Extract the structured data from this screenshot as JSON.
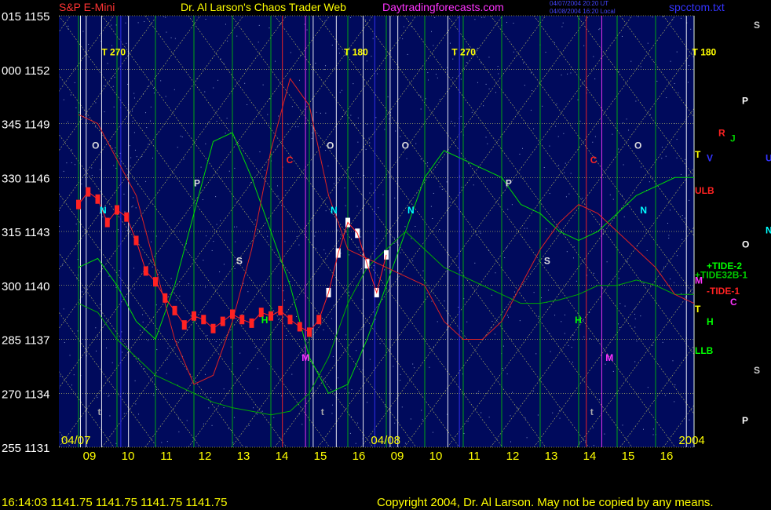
{
  "header": {
    "code_title": "S&P E-Mini",
    "site_title": "Dr. Al Larson's Chaos Trader Web",
    "site_url": "Daytradingforecasts.com",
    "timestamp_1": "04/07/2004 20:20 UT",
    "timestamp_2": "04/08/2004 16:20 Local",
    "file_name": "spcctom.txt"
  },
  "footer": {
    "quote": "16:14:03  1141.75 1141.75 1141.75 1141.75",
    "copyright": "Copyright 2004, Dr. Al Larson. May not be copied by any means."
  },
  "colors": {
    "background": "#000000",
    "plot_bg": "#000a5c",
    "price_bar": "#ff2222",
    "price_bar_today": "#ffffff",
    "tide_line": "#00cc00",
    "red_line": "#dd2222",
    "grid_yellow": "#ffff66",
    "header_red": "#ff3333",
    "header_magenta": "#ff33ff",
    "header_blue": "#3333ff"
  },
  "chart_data": {
    "type": "line",
    "title": "S&P E-Mini",
    "y_labels": [
      {
        "angle": "015",
        "price": "1155"
      },
      {
        "angle": "000",
        "price": "1152"
      },
      {
        "angle": "345",
        "price": "1149"
      },
      {
        "angle": "330",
        "price": "1146"
      },
      {
        "angle": "315",
        "price": "1143"
      },
      {
        "angle": "300",
        "price": "1140"
      },
      {
        "angle": "285",
        "price": "1137"
      },
      {
        "angle": "270",
        "price": "1134"
      },
      {
        "angle": "255",
        "price": "1131"
      }
    ],
    "ylim": [
      1131,
      1155
    ],
    "x_ticks": [
      "09",
      "10",
      "11",
      "12",
      "13",
      "14",
      "15",
      "16",
      "09",
      "10",
      "11",
      "12",
      "13",
      "14",
      "15",
      "16"
    ],
    "date_labels": [
      "04/07",
      "04/08",
      "2004"
    ],
    "hours_per_day": 8,
    "price_series": {
      "name": "S&P E-Mini",
      "x": [
        0,
        0.25,
        0.5,
        0.75,
        1,
        1.25,
        1.5,
        1.75,
        2,
        2.25,
        2.5,
        2.75,
        3,
        3.25,
        3.5,
        3.75,
        4,
        4.25,
        4.5,
        4.75,
        5,
        5.25,
        5.5,
        5.75,
        6,
        6.25,
        6.5,
        6.75,
        7,
        7.25,
        7.5,
        7.75,
        8
      ],
      "y": [
        1144.5,
        1145.2,
        1144.8,
        1143.5,
        1144.2,
        1143.8,
        1142.5,
        1140.8,
        1140.2,
        1139.3,
        1138.6,
        1137.8,
        1138.3,
        1138.1,
        1137.6,
        1138.0,
        1138.4,
        1138.1,
        1137.9,
        1138.5,
        1138.3,
        1138.6,
        1138.1,
        1137.7,
        1137.4,
        1138.1,
        1139.6,
        1141.8,
        1143.5,
        1142.9,
        1141.2,
        1139.6,
        1141.7
      ]
    },
    "series": [
      {
        "name": "TIDE-2",
        "color": "#00dd00",
        "x": [
          0,
          0.5,
          1,
          1.5,
          2,
          2.5,
          3,
          3.5,
          4,
          4.5,
          5,
          5.5,
          6,
          6.5,
          7,
          7.5,
          8,
          8.5,
          9,
          9.5,
          10,
          10.5,
          11,
          11.5,
          12,
          12.5,
          13,
          13.5,
          14,
          14.5,
          15,
          15.5,
          16
        ],
        "y": [
          1141,
          1141.5,
          1140,
          1138,
          1137,
          1140,
          1144,
          1148,
          1148.5,
          1146,
          1143,
          1140,
          1136,
          1134,
          1134.5,
          1137,
          1140,
          1143,
          1146,
          1147.5,
          1147,
          1146.5,
          1146,
          1144.5,
          1144,
          1143,
          1142.5,
          1143,
          1144,
          1145,
          1145.5,
          1146,
          1146
        ]
      },
      {
        "name": "+TIDE32B-1",
        "color": "#00aa00",
        "x": [
          0,
          0.5,
          1,
          1.5,
          2,
          2.5,
          3,
          3.5,
          4,
          4.5,
          5,
          5.5,
          6,
          6.5,
          7,
          7.5,
          8,
          8.5,
          9,
          9.5,
          10,
          10.5,
          11,
          11.5,
          12,
          12.5,
          13,
          13.5,
          14,
          14.5,
          15,
          15.5,
          16
        ],
        "y": [
          1139,
          1138.5,
          1137,
          1136,
          1135,
          1134.5,
          1134,
          1133.5,
          1133.2,
          1133,
          1132.8,
          1133,
          1134,
          1136,
          1139,
          1141,
          1142,
          1143,
          1142,
          1141,
          1140.5,
          1140,
          1139.5,
          1139,
          1139,
          1139.2,
          1139.5,
          1140,
          1140,
          1140.3,
          1140,
          1139.5,
          1139.5
        ]
      },
      {
        "name": "-TIDE-1",
        "color": "#dd2222",
        "x": [
          0,
          0.5,
          1,
          1.5,
          2,
          2.5,
          3,
          3.5,
          4,
          4.5,
          5,
          5.5,
          6,
          6.5,
          7,
          7.5,
          8,
          8.5,
          9,
          9.5,
          10,
          10.5,
          11,
          11.5,
          12,
          12.5,
          13,
          13.5,
          14,
          14.5,
          15,
          15.5,
          16
        ],
        "y": [
          1149.5,
          1149,
          1147,
          1145,
          1141,
          1137,
          1134.5,
          1135,
          1138,
          1142,
          1147.5,
          1151.5,
          1150,
          1145,
          1142,
          1141.5,
          1141,
          1140.5,
          1140,
          1138,
          1137,
          1137,
          1138,
          1140,
          1142,
          1143.5,
          1144.5,
          1144,
          1143,
          1142,
          1141,
          1139.5,
          1139
        ]
      }
    ],
    "point_labels": [
      {
        "text": "T 270",
        "day_x": 0.6,
        "price": 1152.8,
        "color": "#ffff00"
      },
      {
        "text": "T 180",
        "day_x": 6.9,
        "price": 1152.8,
        "color": "#ffff00"
      },
      {
        "text": "T 270",
        "day_x": 9.7,
        "price": 1152.8,
        "color": "#ffff00"
      },
      {
        "text": "T 180",
        "day_x": 15.95,
        "price": 1152.8,
        "color": "#ffff00"
      },
      {
        "text": "O",
        "day_x": 0.35,
        "price": 1147.6,
        "color": "#dddddd"
      },
      {
        "text": "O",
        "day_x": 6.45,
        "price": 1147.6,
        "color": "#dddddd"
      },
      {
        "text": "O",
        "day_x": 8.4,
        "price": 1147.6,
        "color": "#dddddd"
      },
      {
        "text": "O",
        "day_x": 14.45,
        "price": 1147.6,
        "color": "#dddddd"
      },
      {
        "text": "P",
        "day_x": 3.0,
        "price": 1145.5,
        "color": "#dddddd"
      },
      {
        "text": "P",
        "day_x": 11.1,
        "price": 1145.5,
        "color": "#dddddd"
      },
      {
        "text": "S",
        "day_x": 4.1,
        "price": 1141.2,
        "color": "#dddddd"
      },
      {
        "text": "S",
        "day_x": 12.1,
        "price": 1141.2,
        "color": "#dddddd"
      },
      {
        "text": "C",
        "day_x": 5.4,
        "price": 1146.8,
        "color": "#ff2222"
      },
      {
        "text": "C",
        "day_x": 13.3,
        "price": 1146.8,
        "color": "#ff2222"
      },
      {
        "text": "N",
        "day_x": 0.55,
        "price": 1144.0,
        "color": "#00ffff"
      },
      {
        "text": "N",
        "day_x": 6.55,
        "price": 1144.0,
        "color": "#00ffff"
      },
      {
        "text": "N",
        "day_x": 8.55,
        "price": 1144.0,
        "color": "#00ffff"
      },
      {
        "text": "N",
        "day_x": 14.6,
        "price": 1144.0,
        "color": "#00ffff"
      },
      {
        "text": "M",
        "day_x": 5.8,
        "price": 1135.8,
        "color": "#ff33ff"
      },
      {
        "text": "M",
        "day_x": 13.7,
        "price": 1135.8,
        "color": "#ff33ff"
      },
      {
        "text": "H",
        "day_x": 4.75,
        "price": 1137.9,
        "color": "#00ff00"
      },
      {
        "text": "H",
        "day_x": 12.9,
        "price": 1137.9,
        "color": "#00ff00"
      },
      {
        "text": "t",
        "day_x": 0.5,
        "price": 1132.8,
        "color": "#aaaaaa"
      },
      {
        "text": "t",
        "day_x": 6.3,
        "price": 1132.8,
        "color": "#aaaaaa"
      },
      {
        "text": "t",
        "day_x": 13.3,
        "price": 1132.8,
        "color": "#aaaaaa"
      }
    ],
    "right_labels": [
      {
        "text": "T",
        "price": 1147.1,
        "color": "#ffff00",
        "col": 0
      },
      {
        "text": "V",
        "price": 1146.9,
        "color": "#3333ff",
        "col": 1
      },
      {
        "text": "U",
        "price": 1146.9,
        "color": "#3333ff",
        "col": 6
      },
      {
        "text": "ULB",
        "price": 1145.1,
        "color": "#ff2222",
        "col": 0
      },
      {
        "text": "R",
        "price": 1148.3,
        "color": "#ff2222",
        "col": 2
      },
      {
        "text": "J",
        "price": 1148.0,
        "color": "#00cc00",
        "col": 3
      },
      {
        "text": "S",
        "price": 1154.3,
        "color": "#cccccc",
        "col": 5
      },
      {
        "text": "P",
        "price": 1150.1,
        "color": "#ffffff",
        "col": 4
      },
      {
        "text": "O",
        "price": 1142.1,
        "color": "#ffffff",
        "col": 4
      },
      {
        "text": "N",
        "price": 1142.9,
        "color": "#00ffff",
        "col": 6
      },
      {
        "text": "+TIDE-2",
        "price": 1140.9,
        "color": "#00ff00",
        "col": 1
      },
      {
        "text": "+TIDE32B-1",
        "price": 1140.4,
        "color": "#00cc00",
        "col": 0
      },
      {
        "text": "M",
        "price": 1140.1,
        "color": "#ff33ff",
        "col": 0
      },
      {
        "text": "-TIDE-1",
        "price": 1139.5,
        "color": "#ff2222",
        "col": 1
      },
      {
        "text": "C",
        "price": 1138.9,
        "color": "#ff33ff",
        "col": 3
      },
      {
        "text": "T",
        "price": 1138.5,
        "color": "#ffff00",
        "col": 0
      },
      {
        "text": "H",
        "price": 1137.8,
        "color": "#00ff00",
        "col": 1
      },
      {
        "text": "LLB",
        "price": 1136.2,
        "color": "#00ff00",
        "col": 0
      },
      {
        "text": "S",
        "price": 1135.1,
        "color": "#cccccc",
        "col": 5
      },
      {
        "text": "P",
        "price": 1132.3,
        "color": "#ffffff",
        "col": 4
      }
    ]
  }
}
